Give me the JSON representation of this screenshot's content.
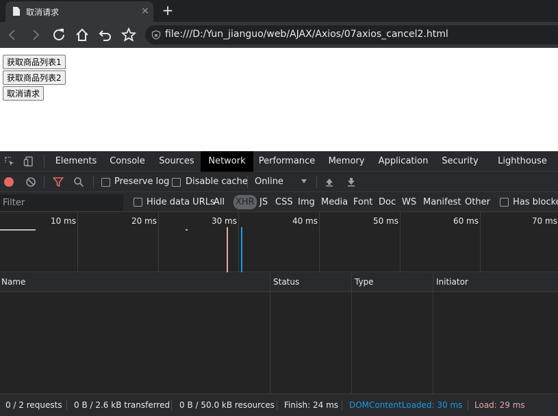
{
  "browser": {
    "tab_title": "取消请求",
    "tab_close": "×",
    "new_tab": "+",
    "url": "file:///D:/Yun_jianguo/web/AJAX/Axios/07axios_cancel2.html"
  },
  "page": {
    "buttons": [
      "获取商品列表1",
      "获取商品列表2",
      "取消请求"
    ]
  },
  "devtools": {
    "tabs": [
      "Elements",
      "Console",
      "Sources",
      "Network",
      "Performance",
      "Memory",
      "Application",
      "Security",
      "Lighthouse"
    ],
    "active_tab": "Network",
    "toolbar": {
      "preserve_log": "Preserve log",
      "disable_cache": "Disable cache",
      "throttling": "Online"
    },
    "filter": {
      "placeholder": "Filter",
      "hide_data_urls": "Hide data URLs",
      "types": [
        "All",
        "XHR",
        "JS",
        "CSS",
        "Img",
        "Media",
        "Font",
        "Doc",
        "WS",
        "Manifest",
        "Other"
      ],
      "active_type": "XHR",
      "has_blocked": "Has blocked"
    },
    "timeline_ticks": [
      "10 ms",
      "20 ms",
      "30 ms",
      "40 ms",
      "50 ms",
      "60 ms",
      "70 ms"
    ],
    "columns": [
      "Name",
      "Status",
      "Type",
      "Initiator"
    ],
    "status": {
      "requests": "0 / 2 requests",
      "transferred": "0 B / 2.6 kB transferred",
      "resources": "0 B / 50.0 kB resources",
      "finish": "Finish: 24 ms",
      "dom_content_loaded": "DOMContentLoaded: 30 ms",
      "load": "Load: 29 ms"
    },
    "colors": {
      "dom_content_loaded": "#1a9ae6",
      "load": "#e8a8a8",
      "record": "#e46962",
      "filter_icon": "#e46962"
    }
  }
}
